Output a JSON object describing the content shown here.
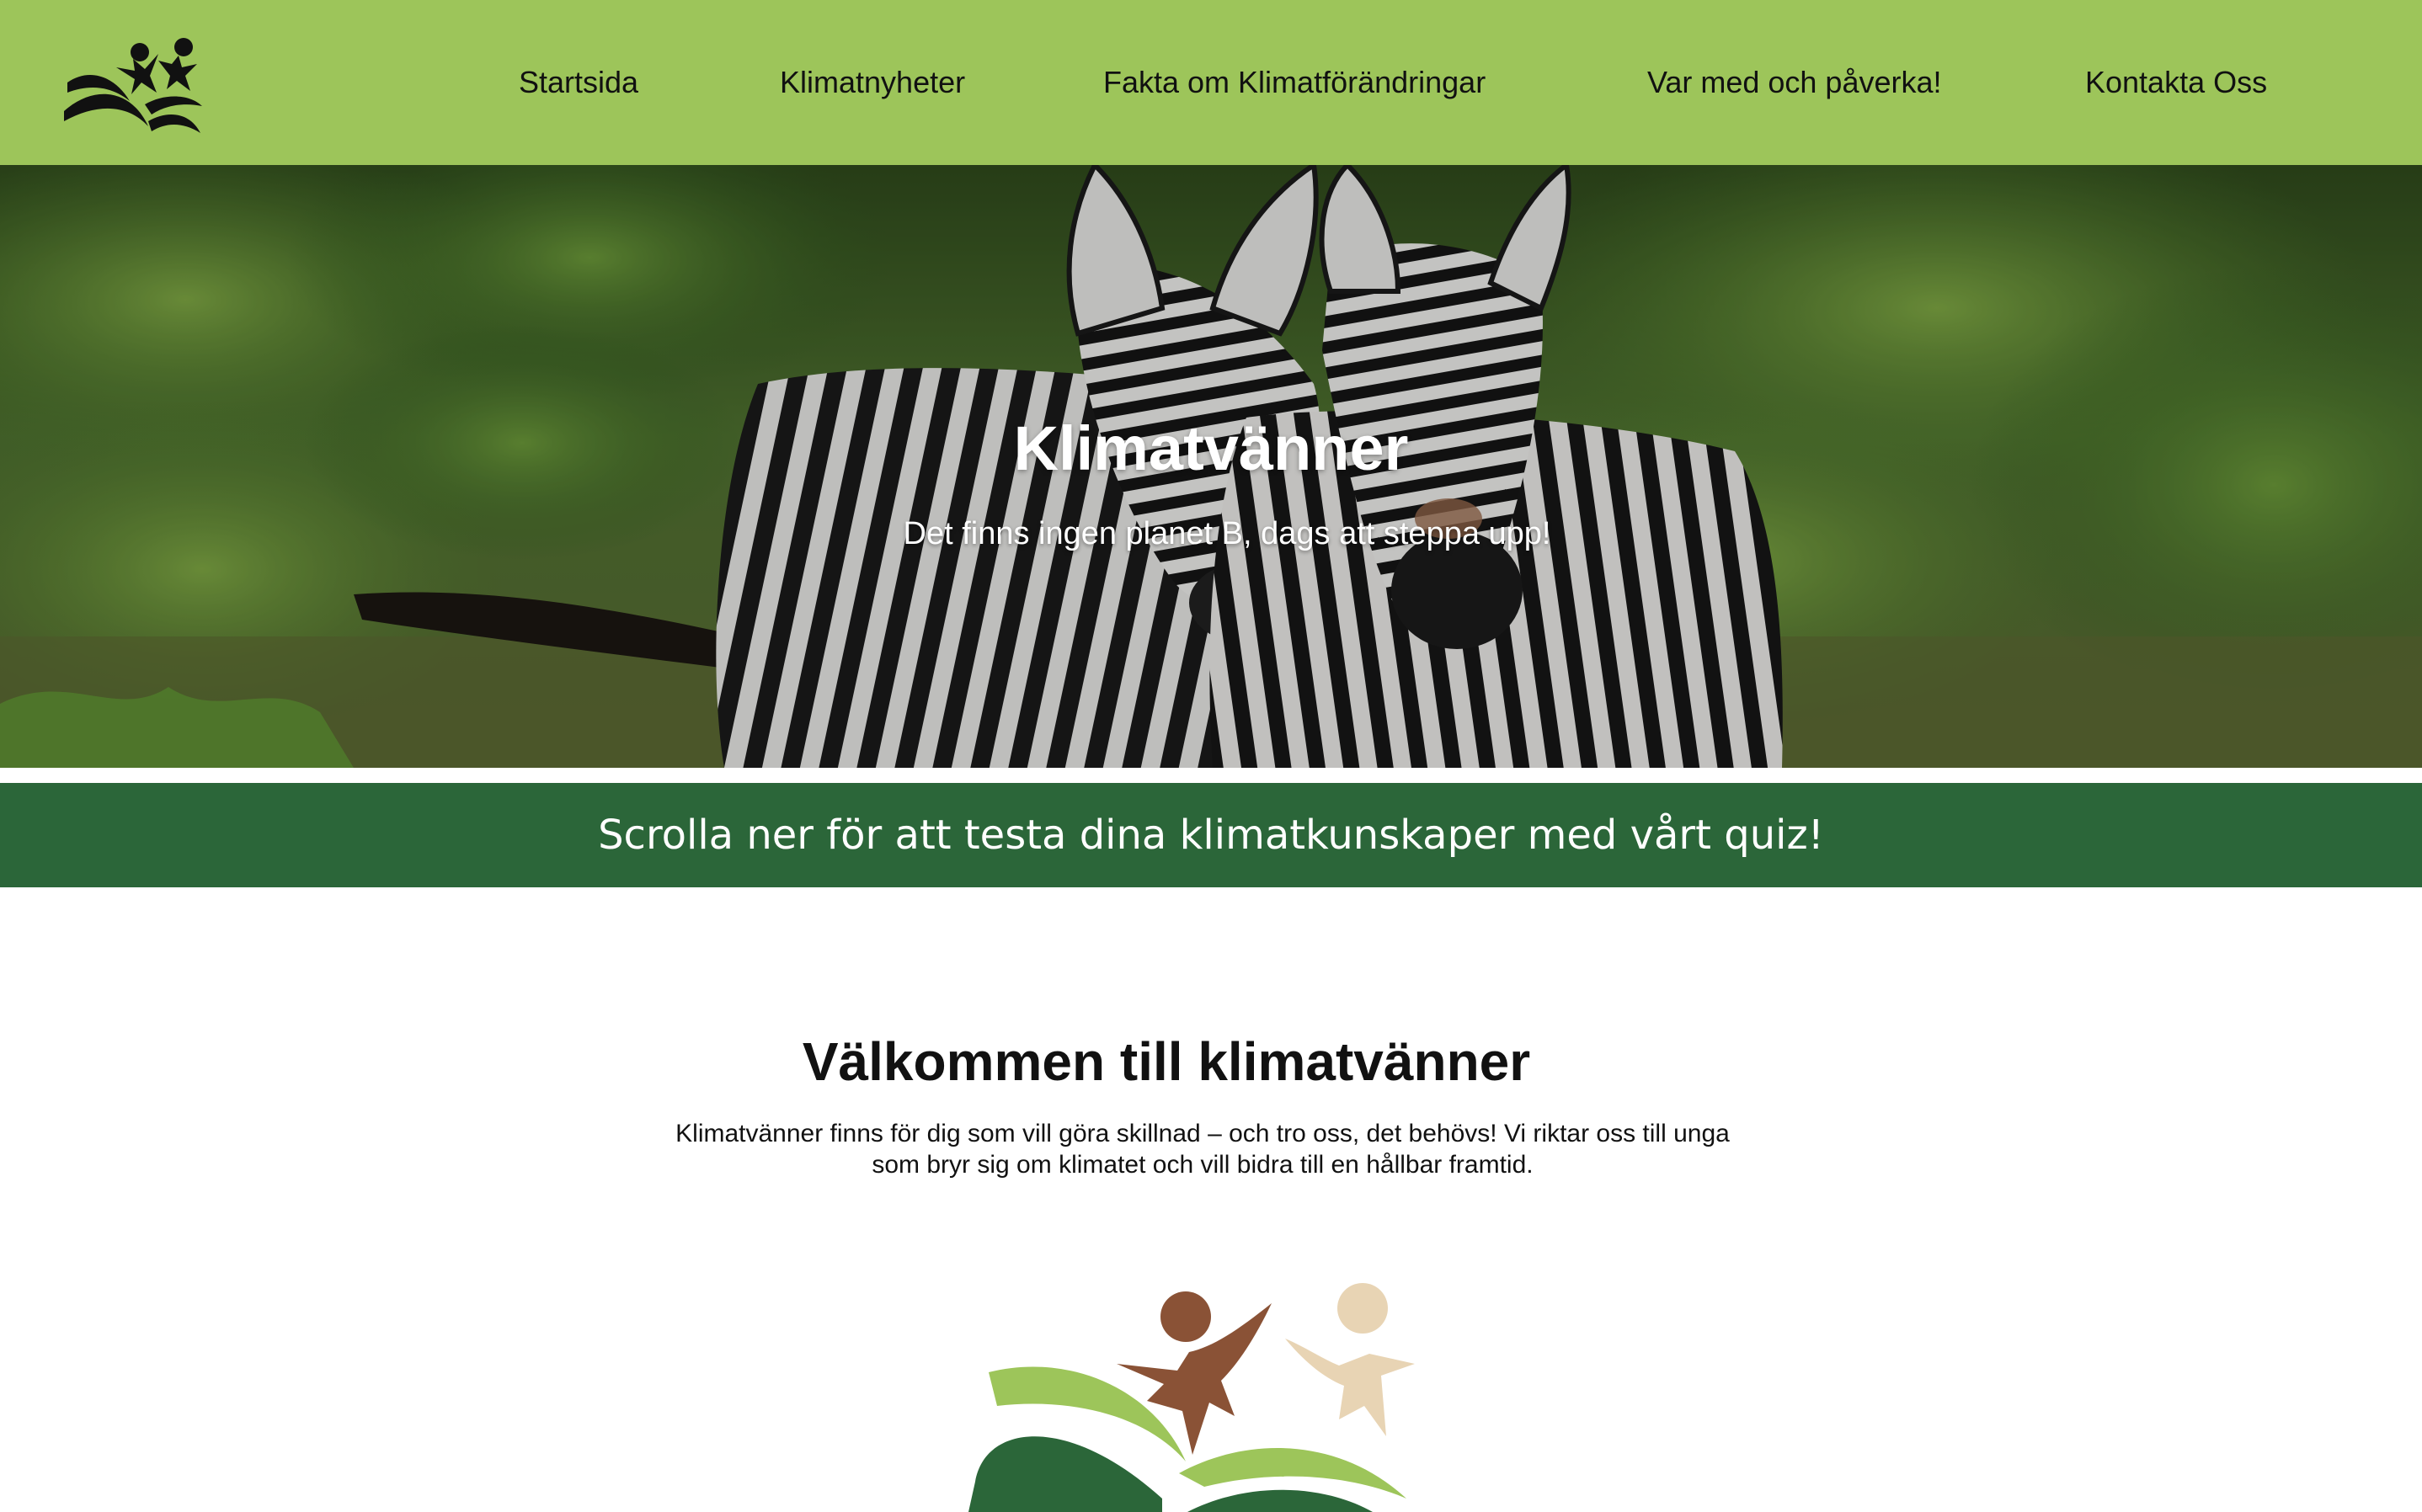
{
  "nav": {
    "items": [
      {
        "label": "Startsida"
      },
      {
        "label": "Klimatnyheter"
      },
      {
        "label": "Fakta om Klimatförändringar"
      },
      {
        "label": "Var med och påverka!"
      },
      {
        "label": "Kontakta Oss"
      }
    ]
  },
  "hero": {
    "title": "Klimatvänner",
    "subtitle": "Det finns ingen planet B, dags att steppa upp!"
  },
  "banner": {
    "text": "Scrolla ner för att testa dina klimatkunskaper med vårt quiz!"
  },
  "welcome": {
    "title": "Välkommen till klimatvänner",
    "text": "Klimatvänner finns för dig som vill göra skillnad – och tro oss, det behövs! Vi riktar oss till unga som bryr sig om klimatet och vill bidra till en hållbar framtid."
  },
  "colors": {
    "header_bg": "#9dc55a",
    "banner_bg": "#2b6639",
    "logo_brown": "#8a5236",
    "logo_beige": "#e8d4b4",
    "logo_light_green": "#9dc55a",
    "logo_dark_green": "#2b6639"
  }
}
